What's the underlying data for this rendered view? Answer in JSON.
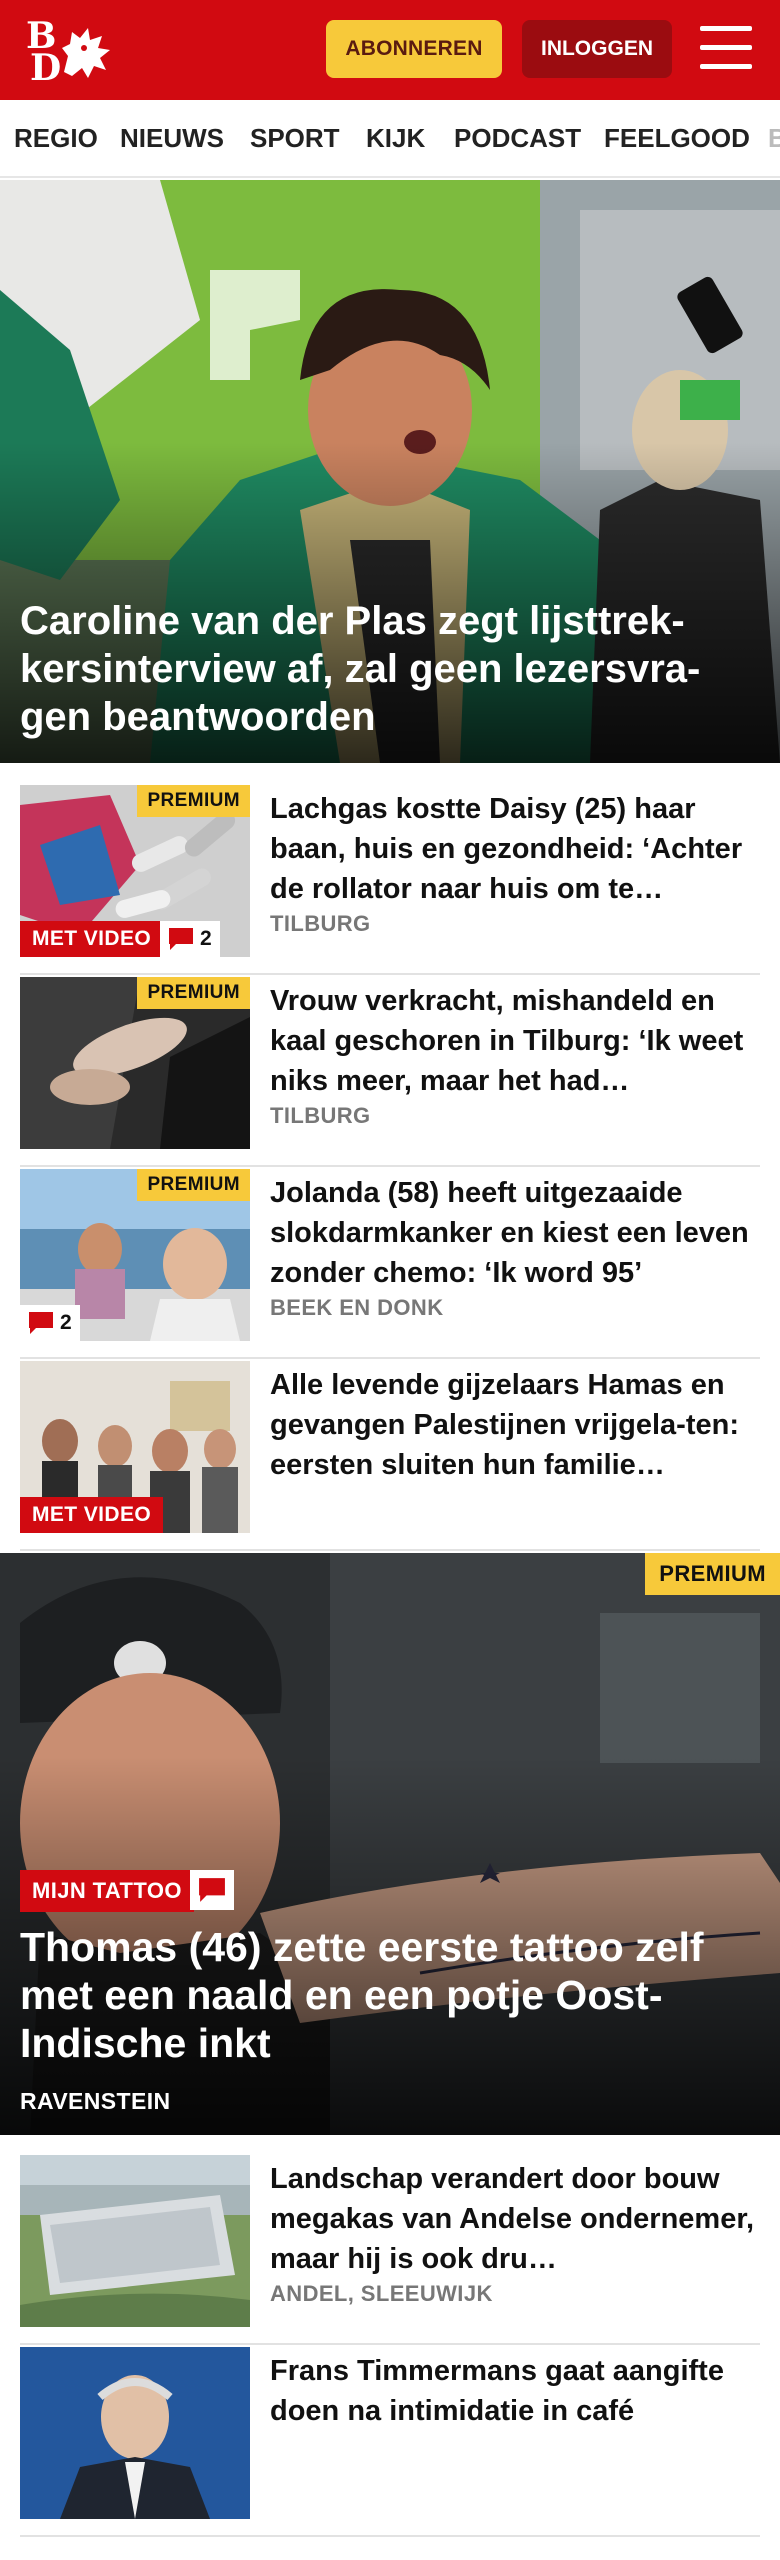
{
  "header": {
    "subscribe_label": "ABONNEREN",
    "login_label": "INLOGGEN",
    "logo_letters": [
      "B",
      "D"
    ],
    "brand_color": "#d10a11"
  },
  "nav": {
    "items": [
      "REGIO",
      "NIEUWS",
      "SPORT",
      "KIJK",
      "PODCAST",
      "FEELGOOD",
      "B"
    ]
  },
  "hero": {
    "title": "Caroline van der Plas zegt lijsttrek-kersinterview af, zal geen lezersvra-gen beantwoorden"
  },
  "articles": [
    {
      "title": "Lachgas kostte Daisy (25) haar baan, huis en gezondheid: ‘Achter de rollator naar huis om te…",
      "location": "TILBURG",
      "premium": "PREMIUM",
      "video": "MET VIDEO",
      "comments": "2"
    },
    {
      "title": "Vrouw verkracht, mishandeld en kaal geschoren in Tilburg: ‘Ik weet niks meer, maar het had…",
      "location": "TILBURG",
      "premium": "PREMIUM"
    },
    {
      "title": "Jolanda (58) heeft uitgezaaide slokdarmkanker en kiest een leven zonder chemo: ‘Ik word 95’",
      "location": "BEEK EN DONK",
      "premium": "PREMIUM",
      "comments": "2"
    },
    {
      "title": "Alle levende gijzelaars Hamas en gevangen Palestijnen vrijgela-ten: eersten sluiten hun familie…",
      "video": "MET VIDEO"
    }
  ],
  "feature": {
    "premium": "PREMIUM",
    "category": "MIJN TATTOO",
    "title": "Thomas (46) zette eerste tattoo zelf met een naald en een potje Oost-Indische inkt",
    "location": "RAVENSTEIN"
  },
  "articles2": [
    {
      "title": "Landschap verandert door bouw megakas van Andelse ondernemer, maar hij is ook dru…",
      "location": "ANDEL, SLEEUWIJK"
    },
    {
      "title": "Frans Timmermans gaat aangifte doen na intimidatie in café"
    }
  ],
  "icons": {
    "menu": "hamburger-menu-icon",
    "comment": "speech-bubble-icon",
    "logo_mark": "dragon-icon"
  }
}
